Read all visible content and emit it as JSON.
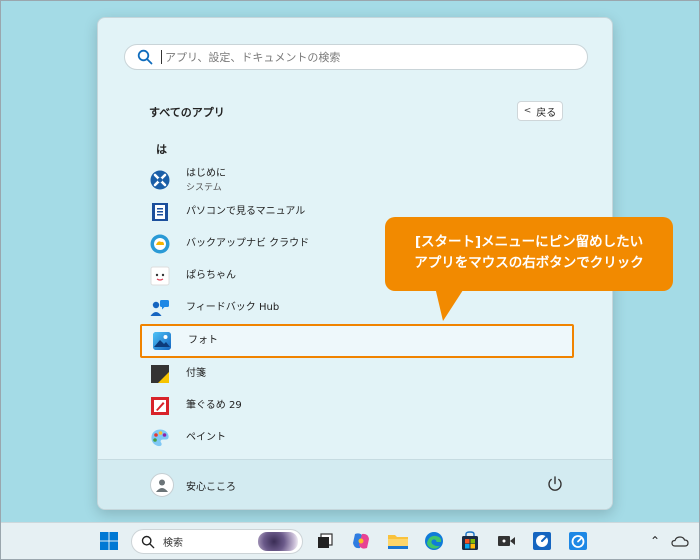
{
  "start_menu": {
    "search": {
      "placeholder": "アプリ、設定、ドキュメントの検索"
    },
    "all_apps_title": "すべてのアプリ",
    "back_button": {
      "label": "戻る"
    },
    "section_letter": "は",
    "apps": [
      {
        "name": "はじめに",
        "sub": "システム",
        "icon": "get-started-icon"
      },
      {
        "name": "パソコンで見るマニュアル",
        "icon": "manual-book-icon"
      },
      {
        "name": "バックアップナビ クラウド",
        "icon": "backup-navi-icon"
      },
      {
        "name": "ぱらちゃん",
        "icon": "parachan-icon"
      },
      {
        "name": "フィードバック Hub",
        "icon": "feedback-hub-icon"
      },
      {
        "name": "フォト",
        "icon": "photos-icon",
        "highlighted": true
      },
      {
        "name": "付箋",
        "icon": "sticky-notes-icon"
      },
      {
        "name": "筆ぐるめ 29",
        "icon": "fudegurume-icon"
      },
      {
        "name": "ペイント",
        "icon": "paint-icon"
      }
    ],
    "user": {
      "name": "安心こころ"
    }
  },
  "callout": {
    "line1": "[スタート]メニューにピン留めしたい",
    "line2": "アプリをマウスの右ボタンでクリック"
  },
  "taskbar": {
    "search_label": "検索",
    "items": [
      "start-icon",
      "task-view-icon",
      "copilot-icon",
      "file-explorer-icon",
      "edge-icon",
      "store-icon",
      "app-icon",
      "app-icon-2",
      "app-icon-3"
    ]
  },
  "colors": {
    "accent": "#f08300",
    "menu_bg": "#e2f3f7",
    "desktop": "#a4dbe6"
  }
}
